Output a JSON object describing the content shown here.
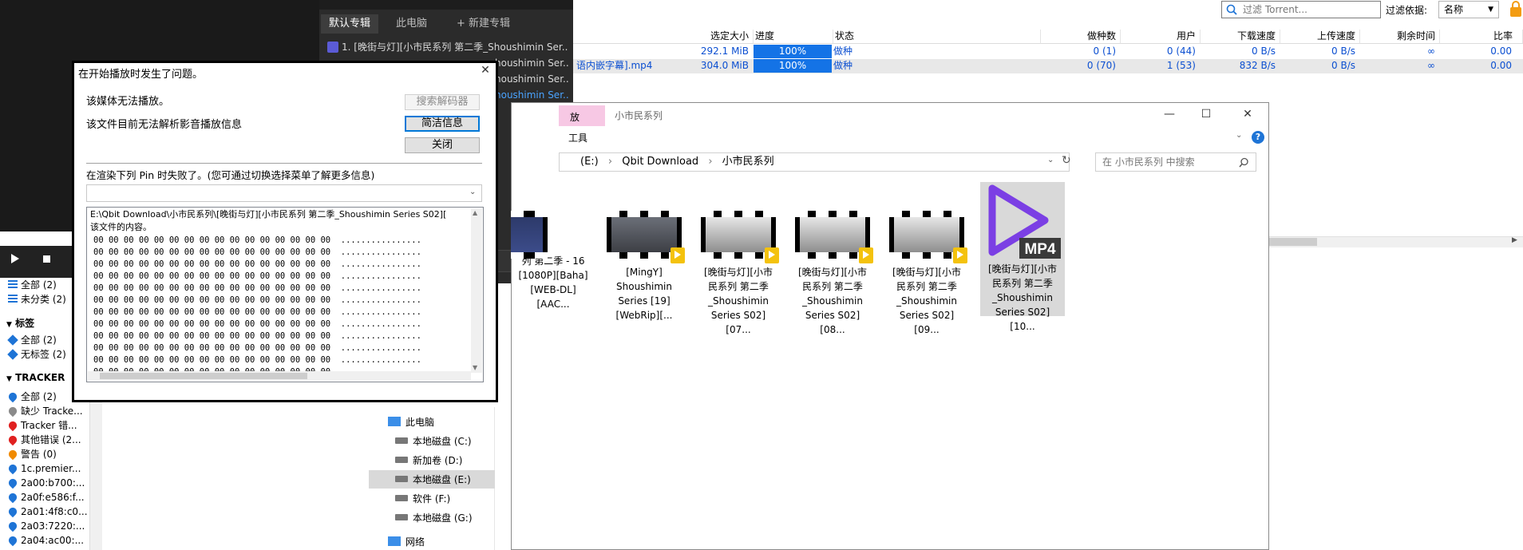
{
  "qbt": {
    "filter": {
      "placeholder": "过滤 Torrent...",
      "label": "过滤依据:",
      "value": "名称"
    },
    "columns": [
      "选定大小",
      "进度",
      "状态",
      "做种数",
      "用户",
      "下载速度",
      "上传速度",
      "剩余时间",
      "比率"
    ],
    "rows": [
      {
        "name": "",
        "size": "292.1 MiB",
        "progress": "100%",
        "status": "做种",
        "seeds": "0 (1)",
        "peers": "0 (44)",
        "down": "0 B/s",
        "up": "0 B/s",
        "eta": "∞",
        "ratio": "0.00"
      },
      {
        "name": "语内嵌字幕].mp4",
        "size": "304.0 MiB",
        "progress": "100%",
        "status": "做种",
        "seeds": "0 (70)",
        "peers": "1 (53)",
        "down": "832 B/s",
        "up": "0 B/s",
        "eta": "∞",
        "ratio": "0.00"
      }
    ],
    "sidebar": {
      "status_items": [
        "全部 (2)",
        "未分类 (2)"
      ],
      "tags_header": "标签",
      "tags": [
        "全部 (2)",
        "无标签 (2)"
      ],
      "tracker_header": "TRACKER",
      "trackers": [
        "全部 (2)",
        "缺少 Tracke...",
        "Tracker 错...",
        "其他错误 (2...",
        "警告 (0)",
        "1c.premier...",
        "2a00:b700:...",
        "2a0f:e586:f...",
        "2a01:4f8:c0...",
        "2a03:7220:...",
        "2a04:ac00:..."
      ],
      "tracker_colors": [
        "#1e74d6",
        "#8a8a8a",
        "#e02020",
        "#e02020",
        "#f08a00",
        "#1e74d6",
        "#1e74d6",
        "#1e74d6",
        "#1e74d6",
        "#1e74d6",
        "#1e74d6"
      ]
    }
  },
  "player": {
    "tabs": [
      "默认专辑",
      "此电脑",
      "+ 新建专辑"
    ],
    "items": [
      "1. [晚街与灯][小市民系列 第二季_Shoushimin Ser...",
      "houshimin Ser...",
      "houshimin Ser...",
      "houshimin Ser..."
    ]
  },
  "explorer": {
    "title": "小市民系列",
    "ribbon_tab": "放",
    "ribbon_tab2": "工具",
    "address": [
      "(E:)",
      "Qbit Download",
      "小市民系列"
    ],
    "search_placeholder": "在 小市民系列 中搜索",
    "nav": [
      "此电脑",
      "本地磁盘 (C:)",
      "新加卷 (D:)",
      "本地磁盘 (E:)",
      "软件 (F:)",
      "本地磁盘 (G:)",
      "网络"
    ],
    "files": [
      "列 第二季 - 16 [1080P][Baha][WEB-DL][AAC...",
      "[MingY] Shoushimin Series [19][WebRip][...",
      "[晚街与灯][小市民系列 第二季 _Shoushimin Series S02][07...",
      "[晚街与灯][小市民系列 第二季 _Shoushimin Series S02][08...",
      "[晚街与灯][小市民系列 第二季 _Shoushimin Series S02][09...",
      "[晚街与灯][小市民系列 第二季 _Shoushimin Series S02][10..."
    ],
    "mp4_label": "MP4"
  },
  "dialog": {
    "title": "在开始播放时发生了问题。",
    "line1": "该媒体无法播放。",
    "line2": "该文件目前无法解析影音播放信息",
    "btn_search": "搜索解码器",
    "btn_brief": "简洁信息",
    "btn_close": "关闭",
    "pin_msg": "在渲染下列 Pin 时失败了。(您可通过切换选择菜单了解更多信息)",
    "path_line": "E:\\Qbit Download\\小市民系列\\[晚街与灯][小市民系列 第二季_Shoushimin Series S02][",
    "content_line": "该文件的内容。",
    "hex_line": "00 00 00 00 00 00 00 00 00 00 00 00 00 00 00 00  ................",
    "hex_count": 12
  }
}
